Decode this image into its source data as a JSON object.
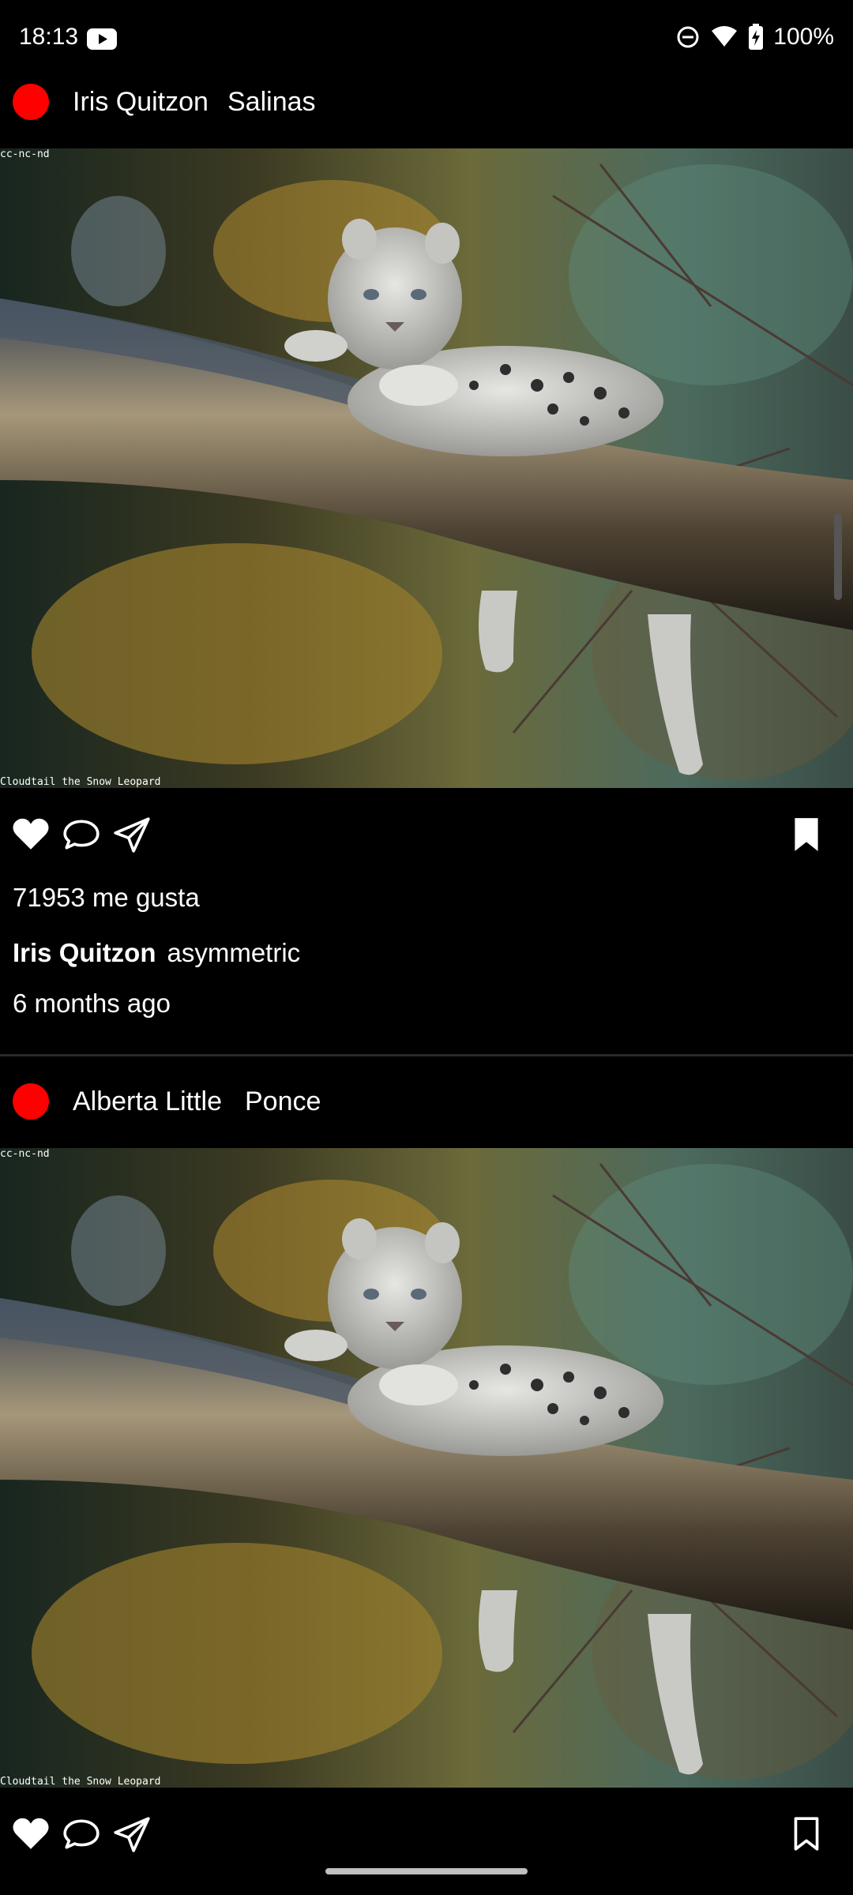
{
  "status_bar": {
    "time": "18:13",
    "battery": "100%",
    "icons": [
      "youtube-icon",
      "do-not-disturb-icon",
      "wifi-icon",
      "battery-charging-icon"
    ]
  },
  "posts": [
    {
      "user": "Iris Quitzon",
      "location": "Salinas",
      "image_license": "cc-nc-nd",
      "image_caption": "Cloudtail the Snow Leopard",
      "likes": "71953 me gusta",
      "caption_user": "Iris Quitzon",
      "caption_text": "asymmetric",
      "time_ago": "6 months ago",
      "bookmarked": true
    },
    {
      "user": "Alberta Little",
      "location": "Ponce",
      "image_license": "cc-nc-nd",
      "image_caption": "Cloudtail the Snow Leopard",
      "bookmarked": false
    }
  ],
  "colors": {
    "background": "#000000",
    "avatar": "#ff0000",
    "text": "#ffffff"
  }
}
